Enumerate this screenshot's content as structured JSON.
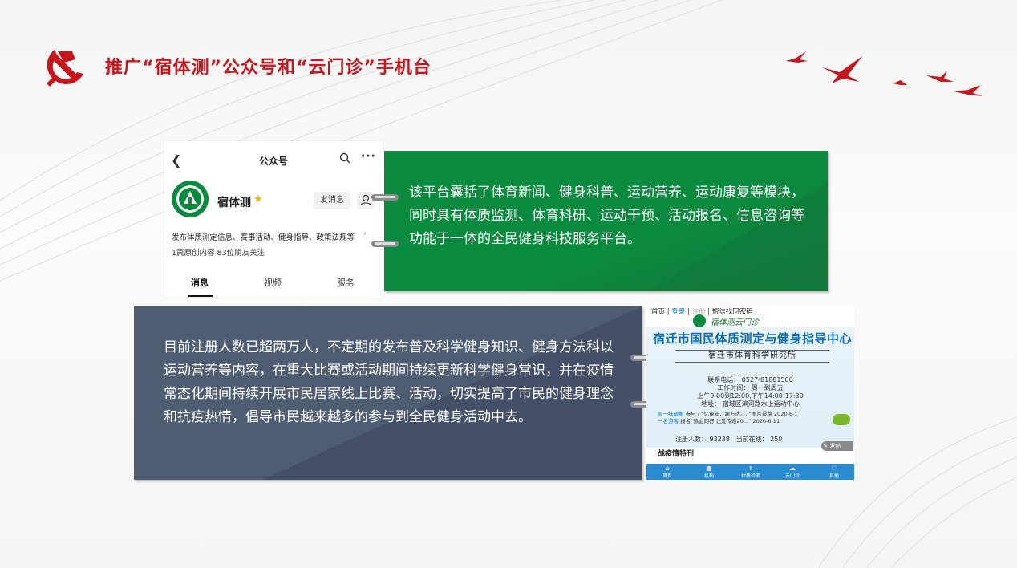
{
  "header": {
    "title": "推广“宿体测”公众号和“云门诊”手机台"
  },
  "wechat": {
    "header_title": "公众号",
    "account_name": "宿体测",
    "message_button": "发消息",
    "description": "发布体质测定信息、赛事活动、健身指导、政策法规等",
    "stats": "1篇原创内容  83位朋友关注",
    "tabs": [
      "消息",
      "视频",
      "服务"
    ]
  },
  "green_panel": {
    "text": "该平台囊括了体育新闻、健身科普、运动营养、运动康复等模块，同时具有体质监测、体育科研、运动干预、活动报名、信息咨询等功能于一体的全民健身科技服务平台。"
  },
  "grey_panel": {
    "text": "目前注册人数已超两万人，不定期的发布普及科学健身知识、健身方法科以运动营养等内容，在重大比赛或活动期间持续更新科学健身常识，并在疫情常态化期间持续开展市民居家线上比赛、活动，切实提高了市民的健身理念和抗疫热情，倡导市民越来越多的参与到全民健身活动中去。"
  },
  "app": {
    "nav_home": "首页",
    "nav_login": "登录",
    "nav_register": "注册",
    "nav_sms": "短信找回密码",
    "brand": "宿体测云门诊",
    "center_name": "宿迁市国民体质测定与健身指导中心",
    "institute": "宿迁市体育科学研究所",
    "phone": "联系电话：  0527-81881500",
    "workdays": "工作时间：  周一到周五",
    "hours": "上午9:00到12:00,下午14:00-17:30",
    "address": "地址：  宿城区滨河路水上运动中心",
    "news1_tag": "那一抹靓搬",
    "news1_text": "参与了“忆童年，趣方达。..”图片投稿",
    "news1_date": "2020-6-1",
    "news2_tag": "一名游客",
    "news2_text": "报名“热血同行 让爱传递20...”",
    "news2_date": "2020-6-11",
    "registered": "注册人数：  93238",
    "online": "当前在线：  250",
    "keyword": "战疫情特刊",
    "fab": "发帖",
    "bottom_tabs": [
      "首页",
      "机构",
      "体质检测",
      "云门诊",
      "其他"
    ]
  },
  "colors": {
    "title_red": "#c8161d",
    "green_panel": "#0a8a3e",
    "grey_panel": "#4f5d73",
    "app_blue": "#2b8bd0"
  }
}
